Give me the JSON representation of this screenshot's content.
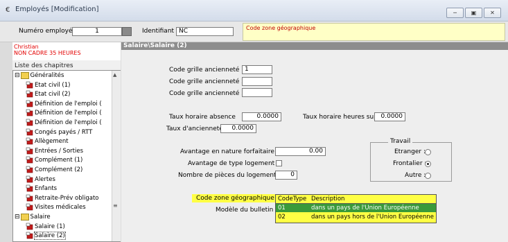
{
  "window": {
    "title": "Employés  [Modification]",
    "title_icon": "€",
    "controls": [
      "minimize-icon",
      "restore-icon",
      "close-icon"
    ]
  },
  "topbar": {
    "num_label": "Numéro employé :",
    "num_value": "1",
    "ident_label": "Identifiant :",
    "ident_value": "NC",
    "hint": "Code zone géographique"
  },
  "employee": {
    "name": "Christian",
    "category": "NON CADRE 35 HEURES"
  },
  "sidebar": {
    "list_label": "Liste des chapitres",
    "items": [
      {
        "label": "Généralités",
        "level": 0,
        "type": "folder",
        "expander": "-"
      },
      {
        "label": "Etat civil (1)",
        "level": 1,
        "type": "page"
      },
      {
        "label": "Etat civil (2)",
        "level": 1,
        "type": "page"
      },
      {
        "label": "Définition de l'emploi (",
        "level": 1,
        "type": "page"
      },
      {
        "label": "Définition de l'emploi (",
        "level": 1,
        "type": "page"
      },
      {
        "label": "Définition de l'emploi (",
        "level": 1,
        "type": "page"
      },
      {
        "label": "Congés payés / RTT",
        "level": 1,
        "type": "page"
      },
      {
        "label": "Allègement",
        "level": 1,
        "type": "page"
      },
      {
        "label": "Entrées / Sorties",
        "level": 1,
        "type": "page"
      },
      {
        "label": "Complément (1)",
        "level": 1,
        "type": "page"
      },
      {
        "label": "Complément (2)",
        "level": 1,
        "type": "page"
      },
      {
        "label": "Alertes",
        "level": 1,
        "type": "page"
      },
      {
        "label": "Enfants",
        "level": 1,
        "type": "page"
      },
      {
        "label": "Retraite-Prév obligato",
        "level": 1,
        "type": "page"
      },
      {
        "label": "Visites médicales",
        "level": 1,
        "type": "page"
      },
      {
        "label": "Salaire",
        "level": 0,
        "type": "folder",
        "expander": "-"
      },
      {
        "label": "Salaire (1)",
        "level": 1,
        "type": "page"
      },
      {
        "label": "Salaire (2)",
        "level": 1,
        "type": "page-selected"
      }
    ]
  },
  "main": {
    "section_title": "Salaire\\Salaire (2)",
    "code_grille_1_label": "Code grille ancienneté 1 :",
    "code_grille_1_value": "1",
    "code_grille_2_label": "Code grille ancienneté 2 :",
    "code_grille_2_value": "",
    "code_grille_3_label": "Code grille ancienneté 3 :",
    "code_grille_3_value": "",
    "taux_absence_label": "Taux horaire absence",
    "taux_absence_value": "0.0000",
    "taux_hs_label": "Taux horaire heures sup",
    "taux_hs_value": "0.0000",
    "taux_anciennete_label": "Taux d'ancienneté :",
    "taux_anciennete_value": "0.0000",
    "avantage_label": "Avantage en nature forfaitaire",
    "avantage_value": "0.00",
    "avantage_logement_label": "Avantage de type logement",
    "avantage_logement_checked": false,
    "nb_pieces_label": "Nombre de pièces du logement",
    "nb_pieces_value": "0",
    "travail_legend": "Travail",
    "travail_options": [
      {
        "label": "Etranger :",
        "selected": false
      },
      {
        "label": "Frontalier :",
        "selected": true
      },
      {
        "label": "Autre :",
        "selected": false
      }
    ],
    "code_zone_label": "Code zone géographique",
    "modele_label": "Modèle du bulletin",
    "dropdown_table": {
      "columns": [
        "CodeType",
        "Description"
      ],
      "rows": [
        {
          "code": "01",
          "description": "dans un pays de l'Union Européenne",
          "selected": true
        },
        {
          "code": "02",
          "description": "dans un pays hors de l'Union Européenne",
          "selected": false
        }
      ]
    }
  },
  "colors": {
    "selected_row": "#3a9a3a",
    "dropdown_bg": "#ffff44",
    "employee_text": "#e30000",
    "hint_bg": "#ffffc6",
    "section_header": "#8d8d8d"
  }
}
